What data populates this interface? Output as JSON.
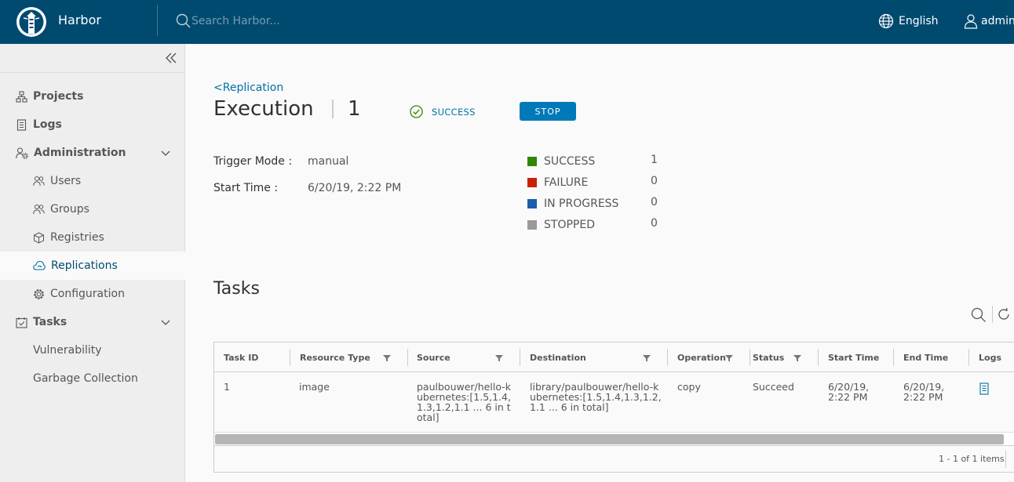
{
  "header": {
    "app_name": "Harbor",
    "search_placeholder": "Search Harbor...",
    "language": "English",
    "user": "admin",
    "bg_color": "#004a70"
  },
  "sidebar": {
    "items": [
      {
        "label": "Projects",
        "icon": "projects-icon"
      },
      {
        "label": "Logs",
        "icon": "logs-icon"
      },
      {
        "label": "Administration",
        "icon": "administration-icon"
      },
      {
        "label": "Users",
        "icon": "users-icon"
      },
      {
        "label": "Groups",
        "icon": "groups-icon"
      },
      {
        "label": "Registries",
        "icon": "registries-icon"
      },
      {
        "label": "Replications",
        "icon": "replications-icon",
        "active": true
      },
      {
        "label": "Configuration",
        "icon": "configuration-icon"
      },
      {
        "label": "Tasks",
        "icon": "tasks-icon"
      },
      {
        "label": "Vulnerability"
      },
      {
        "label": "Garbage Collection"
      }
    ]
  },
  "main": {
    "back_link": "<Replication",
    "title": "Execution",
    "execution_id": "1",
    "status": "SUCCESS",
    "stop_label": "STOP",
    "trigger_mode_label": "Trigger Mode :",
    "trigger_mode_value": "manual",
    "start_time_label": "Start Time :",
    "start_time_value": "6/20/19, 2:22 PM",
    "legend": [
      {
        "label": "SUCCESS",
        "count": "1",
        "color": "#318700"
      },
      {
        "label": "FAILURE",
        "count": "0",
        "color": "#c92100"
      },
      {
        "label": "IN PROGRESS",
        "count": "0",
        "color": "#1d5ca8"
      },
      {
        "label": "STOPPED",
        "count": "0",
        "color": "#9a9a9a"
      }
    ],
    "tasks_title": "Tasks"
  },
  "table": {
    "columns": [
      "Task ID",
      "Resource Type",
      "Source",
      "Destination",
      "Operation",
      "Status",
      "Start Time",
      "End Time",
      "Logs"
    ],
    "rows": [
      {
        "task_id": "1",
        "resource_type": "image",
        "source": "paulbouwer/hello-kubernetes:[1.5,1.4,1.3,1.2,1.1 ... 6 in total]",
        "destination": "library/paulbouwer/hello-kubernetes:[1.5,1.4,1.3,1.2,1.1 ... 6 in total]",
        "operation": "copy",
        "status": "Succeed",
        "start_time": "6/20/19, 2:22 PM",
        "end_time": "6/20/19, 2:22 PM"
      }
    ],
    "footer": "1 - 1 of 1 items"
  }
}
